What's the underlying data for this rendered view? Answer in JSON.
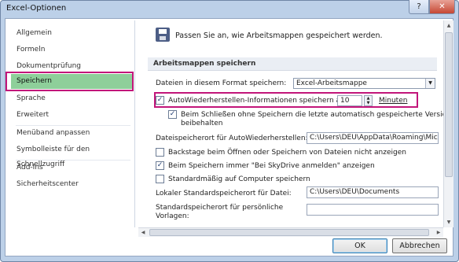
{
  "window": {
    "title": "Excel-Optionen",
    "help_label": "?",
    "close_label": "✕"
  },
  "sidebar": {
    "items": [
      {
        "label": "Allgemein"
      },
      {
        "label": "Formeln"
      },
      {
        "label": "Dokumentprüfung"
      },
      {
        "label": "Speichern"
      },
      {
        "label": "Sprache"
      },
      {
        "label": "Erweitert"
      },
      {
        "label": "Menüband anpassen"
      },
      {
        "label": "Symbolleiste für den Schnellzugriff"
      },
      {
        "label": "Add-Ins"
      },
      {
        "label": "Sicherheitscenter"
      }
    ],
    "active_index": 3
  },
  "main": {
    "intro": "Passen Sie an, wie Arbeitsmappen gespeichert werden.",
    "section_title": "Arbeitsmappen speichern",
    "format_label": "Dateien in diesem Format speichern:",
    "format_value": "Excel-Arbeitsmappe",
    "autorecover_label": "AutoWiederherstellen-Informationen speichern alle",
    "autorecover_checked": true,
    "autorecover_minutes": "10",
    "minutes_label": "Minuten",
    "keep_last_label_1": "Beim Schließen ohne Speichern die letzte automatisch gespeicherte Version",
    "keep_last_label_2": "beibehalten",
    "keep_last_checked": true,
    "autorecover_location_label": "Dateispeicherort für AutoWiederherstellen:",
    "autorecover_location_value": "C:\\Users\\DEU\\AppData\\Roaming\\Micro",
    "backstage_label": "Backstage beim Öffnen oder Speichern von Dateien nicht anzeigen",
    "backstage_checked": false,
    "skydrive_label": "Beim Speichern immer \"Bei SkyDrive anmelden\" anzeigen",
    "skydrive_checked": true,
    "default_computer_label": "Standardmäßig auf Computer speichern",
    "default_computer_checked": false,
    "local_default_label": "Lokaler Standardspeicherort für Datei:",
    "local_default_value": "C:\\Users\\DEU\\Documents",
    "templates_label_1": "Standardspeicherort für persönliche",
    "templates_label_2": "Vorlagen:",
    "templates_value": ""
  },
  "buttons": {
    "ok": "OK",
    "cancel": "Abbrechen"
  },
  "colors": {
    "highlight": "#c2167a",
    "active_nav": "#8ecf9a"
  }
}
